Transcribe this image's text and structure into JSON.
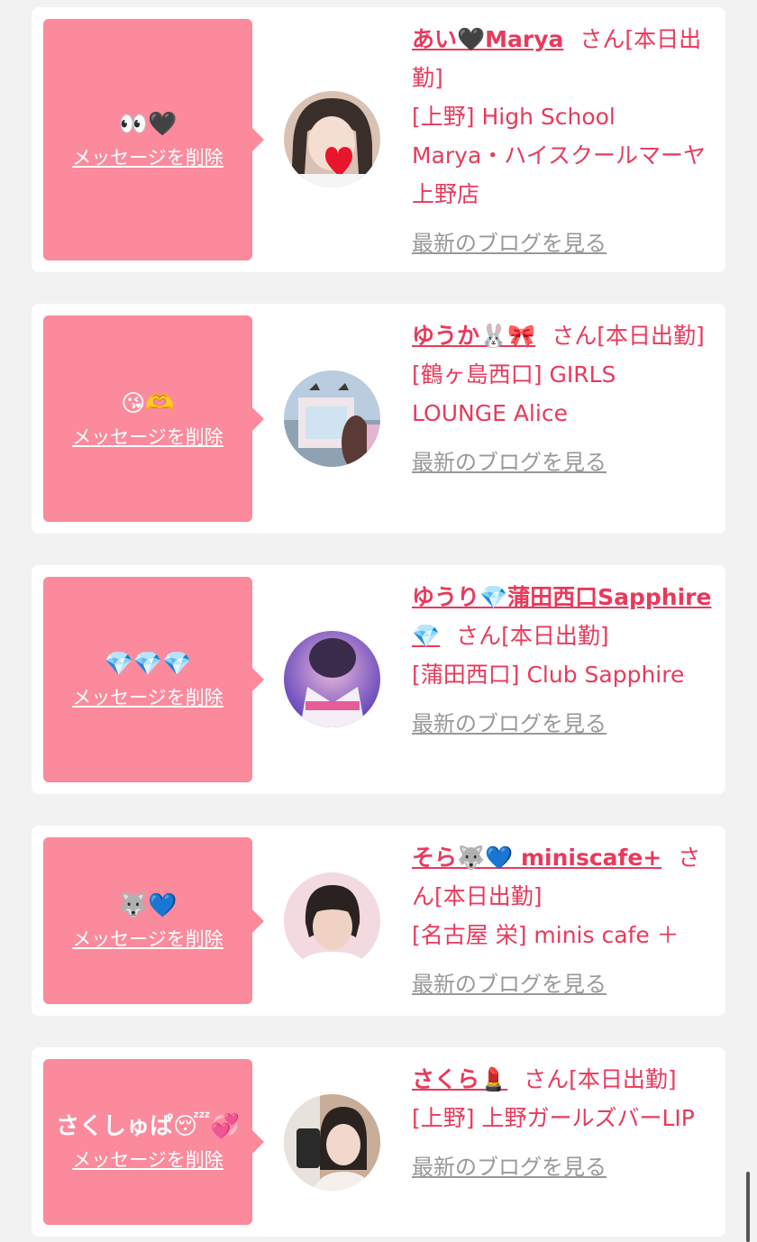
{
  "items": [
    {
      "message": "👀🖤",
      "delete_label": "メッセージを削除",
      "name": "あい🖤Marya",
      "honorific": "さん[本日出勤]",
      "shop": "[上野] High School Marya・ハイスクールマーヤ上野店",
      "blog_label": "最新のブログを見る",
      "avatar_colors": [
        "#d9c2b4",
        "#3a2e2a"
      ]
    },
    {
      "message": "😘🫶",
      "delete_label": "メッセージを削除",
      "name": "ゆうか🐰🎀",
      "honorific": "さん[本日出勤]",
      "shop": "[鶴ヶ島西口] GIRLS LOUNGE Alice",
      "blog_label": "最新のブログを見る",
      "avatar_colors": [
        "#b9cce0",
        "#f0e6ea"
      ]
    },
    {
      "message": "💎💎💎",
      "delete_label": "メッセージを削除",
      "name": "ゆうり💎蒲田西口Sapphire💎",
      "honorific": "さん[本日出勤]",
      "shop": "[蒲田西口] Club Sapphire",
      "blog_label": "最新のブログを見る",
      "avatar_colors": [
        "#6b4fd8",
        "#e9b9d9"
      ]
    },
    {
      "message": "🐺💙",
      "delete_label": "メッセージを削除",
      "name": "そら🐺💙 miniscafe+",
      "honorific": "さん[本日出勤]",
      "shop": "[名古屋 栄] minis cafe ＋",
      "blog_label": "最新のブログを見る",
      "avatar_colors": [
        "#f3d9e0",
        "#2a2220"
      ]
    },
    {
      "message": "さくしゅぱ😴💞",
      "delete_label": "メッセージを削除",
      "name": "さくら💄",
      "honorific": "さん[本日出勤]",
      "shop": "[上野] 上野ガールズバーLIP",
      "blog_label": "最新のブログを見る",
      "avatar_colors": [
        "#c8ad98",
        "#2b2320"
      ]
    }
  ]
}
